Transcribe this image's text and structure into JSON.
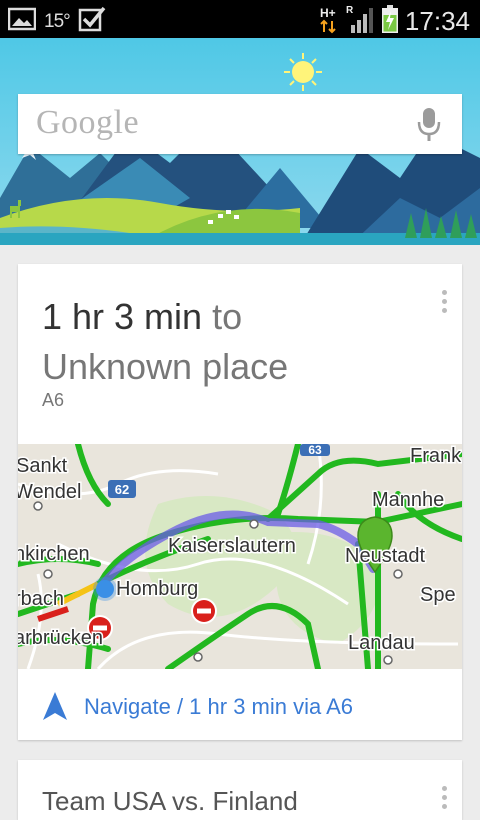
{
  "status_bar": {
    "temperature": "15°",
    "network": "H+",
    "roaming": "R",
    "time": "17:34"
  },
  "search": {
    "logo_text": "Google"
  },
  "traffic_card": {
    "duration": "1 hr 3 min",
    "to_word": "to",
    "destination": "Unknown place",
    "route": "A6",
    "navigate_label": "Navigate / 1 hr 3 min via A6",
    "map": {
      "labels": {
        "sankt": "Sankt",
        "wendel": "Wendel",
        "neunkirchen": "nkirchen",
        "homburg": "Homburg",
        "kaiserslautern": "Kaiserslautern",
        "neustadt": "Neustadt",
        "mannheim": "Mannhe",
        "frankenthal": "Frank",
        "speyer": "Spe",
        "landau": "Landau",
        "saarbrucken": "arbrücken",
        "sulzbach": "rbach",
        "shield_62": "62",
        "shield_63": "63"
      }
    }
  },
  "next_card": {
    "title": "Team USA vs. Finland"
  },
  "colors": {
    "accent_blue": "#3a7bd5",
    "traffic_green": "#22b81f",
    "route_purple": "#6b5ce7"
  }
}
